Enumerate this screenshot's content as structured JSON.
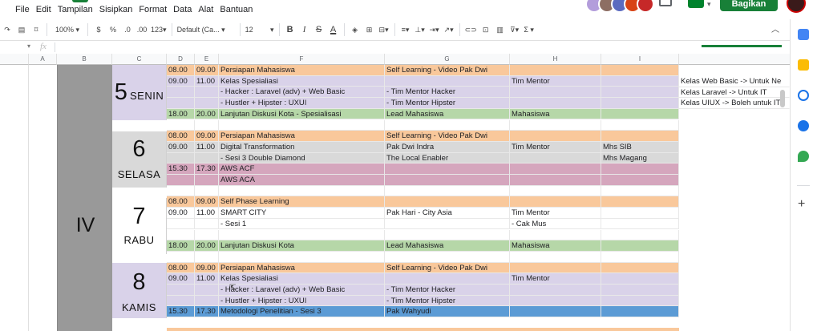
{
  "menu": [
    "File",
    "Edit",
    "Tampilan",
    "Sisipkan",
    "Format",
    "Data",
    "Alat",
    "Bantuan"
  ],
  "share_label": "Bagikan",
  "toolbar": {
    "zoom": "100%",
    "currency": "$",
    "percent": "%",
    "dec_dec": ".0",
    "dec_inc": ".00",
    "more_formats": "123",
    "font": "Default (Ca...",
    "font_size": "12",
    "bold": "B",
    "italic": "I",
    "strike": "S",
    "text_color": "A",
    "sigma": "Σ"
  },
  "formula": {
    "fx": "fx"
  },
  "columns": [
    "A",
    "B",
    "C",
    "D",
    "E",
    "F",
    "G",
    "H",
    "I"
  ],
  "week_label": "IV",
  "days": [
    {
      "num": "5",
      "name": "SENIN"
    },
    {
      "num": "6",
      "name": "SELASA"
    },
    {
      "num": "7",
      "name": "RABU"
    },
    {
      "num": "8",
      "name": "KAMIS"
    }
  ],
  "rows": [
    {
      "color": "#f9c89b",
      "d": "08.00",
      "e": "09.00",
      "f": "Persiapan Mahasiswa",
      "g": "Self Learning - Video Pak Dwi",
      "h": "",
      "i": ""
    },
    {
      "color": "#d9d2e9",
      "d": "09.00",
      "e": "11.00",
      "f": "Kelas Spesialiasi",
      "g": "",
      "h": "Tim Mentor",
      "i": ""
    },
    {
      "color": "#d9d2e9",
      "d": "",
      "e": "",
      "f": "- Hacker : Laravel (adv) + Web Basic",
      "g": "- Tim Mentor Hacker",
      "h": "",
      "i": ""
    },
    {
      "color": "#d9d2e9",
      "d": "",
      "e": "",
      "f": "- Hustler + Hipster : UXUI",
      "g": "- Tim Mentor Hipster",
      "h": "",
      "i": ""
    },
    {
      "color": "#b6d7a8",
      "d": "18.00",
      "e": "20.00",
      "f": "Lanjutan Diskusi Kota - Spesialisasi",
      "g": "Lead Mahasiswa",
      "h": "Mahasiswa",
      "i": ""
    },
    {
      "color": "#ffffff",
      "d": "",
      "e": "",
      "f": "",
      "g": "",
      "h": "",
      "i": ""
    },
    {
      "color": "#f9c89b",
      "d": "08.00",
      "e": "09.00",
      "f": "Persiapan Mahasiswa",
      "g": "Self Learning - Video Pak Dwi",
      "h": "",
      "i": ""
    },
    {
      "color": "#d9d9d9",
      "d": "09.00",
      "e": "11.00",
      "f": "Digital Transformation",
      "g": "Pak Dwi Indra",
      "h": "Tim Mentor",
      "i": "Mhs SIB"
    },
    {
      "color": "#d9d9d9",
      "d": "",
      "e": "",
      "f": "- Sesi 3 Double Diamond",
      "g": "The Local Enabler",
      "h": "",
      "i": "Mhs Magang"
    },
    {
      "color": "#d5a6bd",
      "d": "15.30",
      "e": "17.30",
      "f": "AWS ACF",
      "g": "",
      "h": "",
      "i": ""
    },
    {
      "color": "#d5a6bd",
      "d": "",
      "e": "",
      "f": "AWS ACA",
      "g": "",
      "h": "",
      "i": ""
    },
    {
      "color": "#ffffff",
      "d": "",
      "e": "",
      "f": "",
      "g": "",
      "h": "",
      "i": ""
    },
    {
      "color": "#f9c89b",
      "d": "08.00",
      "e": "09.00",
      "f": "Self Phase Learning",
      "g": "",
      "h": "",
      "i": ""
    },
    {
      "color": "#ffffff",
      "d": "09.00",
      "e": "11.00",
      "f": "SMART CITY",
      "g": "Pak Hari - City Asia",
      "h": "Tim Mentor",
      "i": ""
    },
    {
      "color": "#ffffff",
      "d": "",
      "e": "",
      "f": "- Sesi 1",
      "g": "",
      "h": "- Cak Mus",
      "i": ""
    },
    {
      "color": "#ffffff",
      "d": "",
      "e": "",
      "f": "",
      "g": "",
      "h": "",
      "i": ""
    },
    {
      "color": "#b6d7a8",
      "d": "18.00",
      "e": "20.00",
      "f": "Lanjutan Diskusi Kota",
      "g": "Lead Mahasiswa",
      "h": "Mahasiswa",
      "i": ""
    },
    {
      "color": "#ffffff",
      "d": "",
      "e": "",
      "f": "",
      "g": "",
      "h": "",
      "i": ""
    },
    {
      "color": "#f9c89b",
      "d": "08.00",
      "e": "09.00",
      "f": "Persiapan Mahasiswa",
      "g": "Self Learning - Video Pak Dwi",
      "h": "",
      "i": ""
    },
    {
      "color": "#d9d2e9",
      "d": "09.00",
      "e": "11.00",
      "f": "Kelas Spesialiasi",
      "g": "",
      "h": "Tim Mentor",
      "i": ""
    },
    {
      "color": "#d9d2e9",
      "d": "",
      "e": "",
      "f": "- Hacker : Laravel (adv) + Web Basic",
      "g": "- Tim Mentor Hacker",
      "h": "",
      "i": ""
    },
    {
      "color": "#d9d2e9",
      "d": "",
      "e": "",
      "f": "- Hustler + Hipster : UXUI",
      "g": "- Tim Mentor Hipster",
      "h": "",
      "i": ""
    },
    {
      "color": "#5b9bd5",
      "d": "15.30",
      "e": "17.30",
      "f": "Metodologi Penelitian - Sesi 3",
      "g": "Pak Wahyudi",
      "h": "",
      "i": ""
    }
  ],
  "notes": [
    "Kelas Web Basic -> Untuk Ne",
    "Kelas Laravel -> Untuk IT",
    "Kelas UIUX -> Boleh untuk IT"
  ],
  "colors": {
    "share": "#188038",
    "orange": "#f9c89b",
    "lavender": "#d9d2e9",
    "green": "#b6d7a8",
    "gray": "#d9d9d9",
    "pink": "#d5a6bd",
    "blue": "#5b9bd5"
  }
}
